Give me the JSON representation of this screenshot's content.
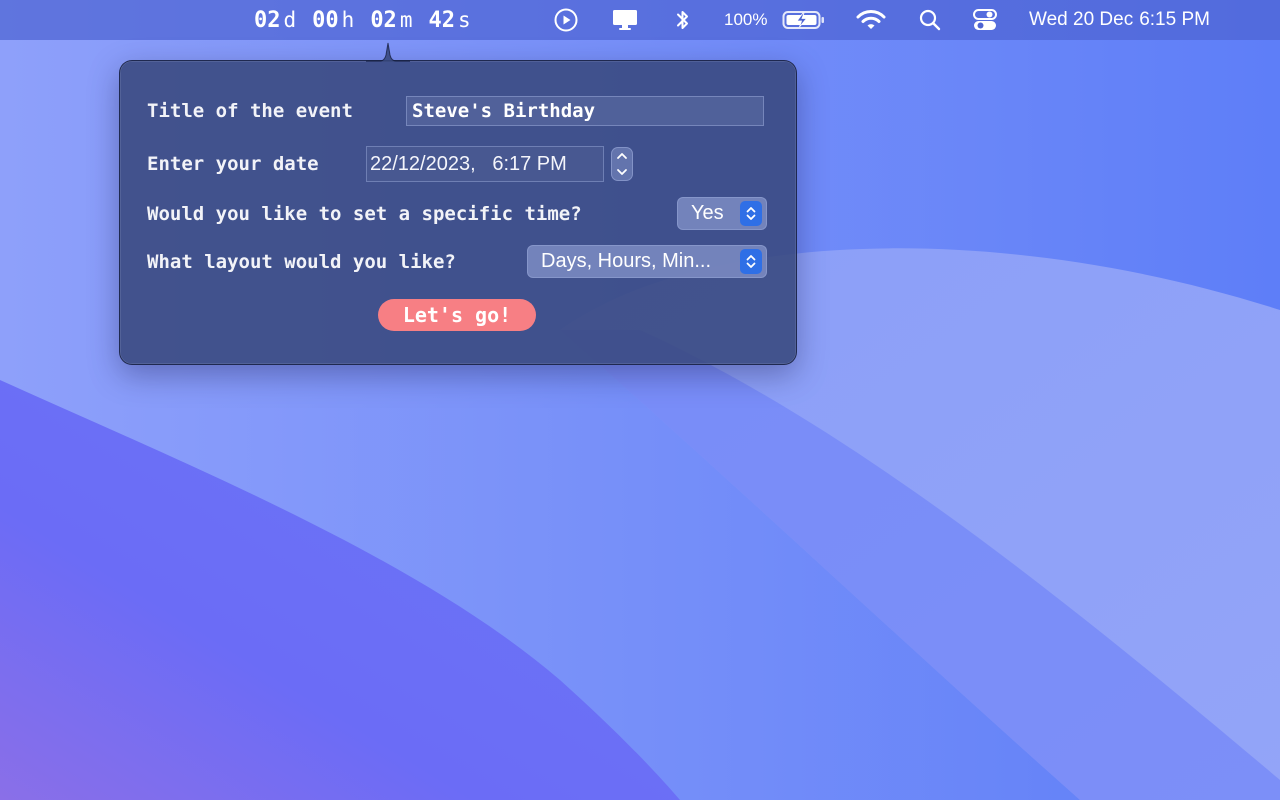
{
  "menubar": {
    "countdown": {
      "days": "02",
      "days_unit": "d",
      "hours": "00",
      "hours_unit": "h",
      "minutes": "02",
      "minutes_unit": "m",
      "seconds": "42",
      "seconds_unit": "s"
    },
    "icons": [
      "play-circle-icon",
      "display-icon",
      "bluetooth-icon",
      "battery-icon",
      "wifi-icon",
      "search-icon",
      "control-center-icon"
    ],
    "battery_percent": "100%",
    "date": "Wed 20 Dec",
    "time": "6:15 PM"
  },
  "form": {
    "title_label": "Title of the event",
    "title_value": "Steve's Birthday",
    "date_label": "Enter your date",
    "date_value": "22/12/2023,   6:17 PM",
    "specific_time_label": "Would you like to set a specific time?",
    "specific_time_value": "Yes",
    "layout_label": "What layout would you like?",
    "layout_value": "Days, Hours, Min...",
    "submit_label": "Let's go!"
  },
  "colors": {
    "menubar_bg": "#4e64d2",
    "popover_bg": "#38487d",
    "popup_chevron": "#2f6fe6",
    "submit_button": "#f77f84"
  }
}
